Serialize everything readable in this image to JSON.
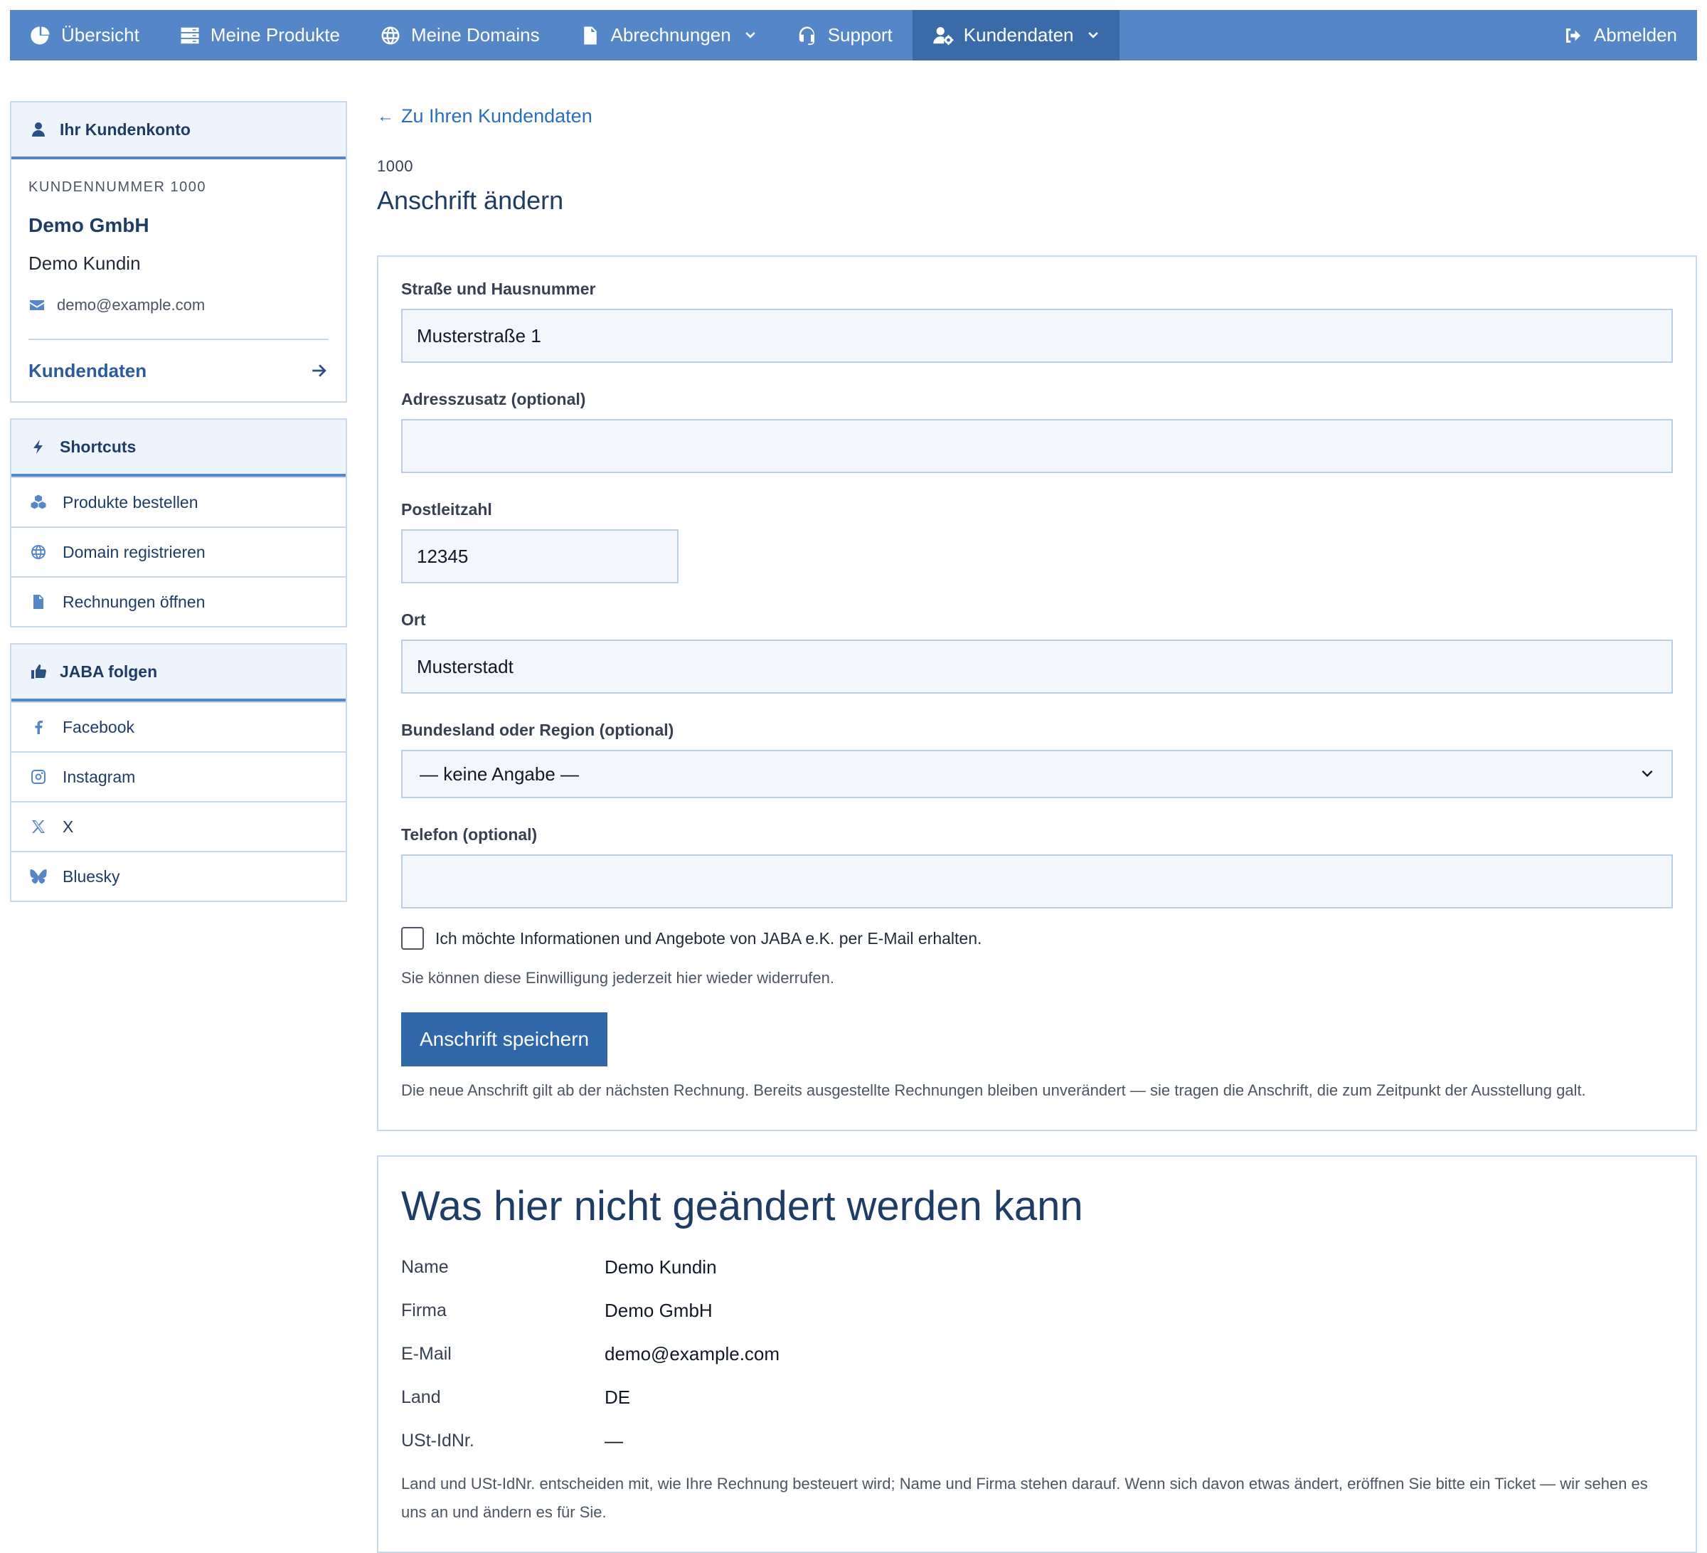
{
  "nav": {
    "items": [
      {
        "label": "Übersicht",
        "icon": "chart-pie-icon"
      },
      {
        "label": "Meine Produkte",
        "icon": "server-icon"
      },
      {
        "label": "Meine Domains",
        "icon": "globe-icon"
      },
      {
        "label": "Abrechnungen",
        "icon": "document-icon",
        "dropdown": true
      },
      {
        "label": "Support",
        "icon": "headset-icon"
      },
      {
        "label": "Kundendaten",
        "icon": "user-gear-icon",
        "dropdown": true,
        "active": true
      }
    ],
    "logout": "Abmelden"
  },
  "sidebar": {
    "account": {
      "title": "Ihr Kundenkonto",
      "number_label": "KUNDENNUMMER 1000",
      "company": "Demo GmbH",
      "person": "Demo Kundin",
      "email": "demo@example.com",
      "link": "Kundendaten"
    },
    "shortcuts": {
      "title": "Shortcuts",
      "items": [
        {
          "label": "Produkte bestellen",
          "icon": "cubes-icon"
        },
        {
          "label": "Domain registrieren",
          "icon": "globe-icon"
        },
        {
          "label": "Rechnungen öffnen",
          "icon": "invoice-icon"
        }
      ]
    },
    "follow": {
      "title": "JABA folgen",
      "items": [
        {
          "label": "Facebook",
          "icon": "facebook-icon"
        },
        {
          "label": "Instagram",
          "icon": "instagram-icon"
        },
        {
          "label": "X",
          "icon": "x-icon"
        },
        {
          "label": "Bluesky",
          "icon": "bluesky-icon"
        }
      ]
    }
  },
  "main": {
    "back_link": "Zu Ihren Kundendaten",
    "back_arrow": "←",
    "kicker": "1000",
    "title": "Anschrift ändern",
    "form": {
      "street_label": "Straße und Hausnummer",
      "street_value": "Musterstraße 1",
      "addr2_label": "Adresszusatz (optional)",
      "addr2_value": "",
      "zip_label": "Postleitzahl",
      "zip_value": "12345",
      "city_label": "Ort",
      "city_value": "Musterstadt",
      "region_label": "Bundesland oder Region (optional)",
      "region_value": "— keine Angabe —",
      "phone_label": "Telefon (optional)",
      "phone_value": "",
      "newsletter_label": "Ich möchte Informationen und Angebote von JABA e.K. per E-Mail erhalten.",
      "newsletter_checked": false,
      "newsletter_help": "Sie können diese Einwilligung jederzeit hier wieder widerrufen.",
      "submit": "Anschrift speichern",
      "note": "Die neue Anschrift gilt ab der nächsten Rechnung. Bereits ausgestellte Rechnungen bleiben unverändert — sie tragen die Anschrift, die zum Zeitpunkt der Ausstellung galt."
    },
    "info": {
      "title": "Was hier nicht geändert werden kann",
      "rows": [
        {
          "key": "Name",
          "value": "Demo Kundin"
        },
        {
          "key": "Firma",
          "value": "Demo GmbH"
        },
        {
          "key": "E-Mail",
          "value": "demo@example.com"
        },
        {
          "key": "Land",
          "value": "DE"
        },
        {
          "key": "USt-IdNr.",
          "value": "—"
        }
      ],
      "note": "Land und USt-IdNr. entscheiden mit, wie Ihre Rechnung besteuert wird; Name und Firma stehen darauf. Wenn sich davon etwas ändert, eröffnen Sie bitte ein Ticket — wir sehen es uns an und ändern es für Sie."
    }
  },
  "colors": {
    "nav_bg": "#5586c8",
    "nav_active": "#3b6aa8",
    "primary_button": "#2f67a8",
    "link": "#2a6ebd",
    "heading": "#1d3d66",
    "border": "#c9d9ee"
  }
}
